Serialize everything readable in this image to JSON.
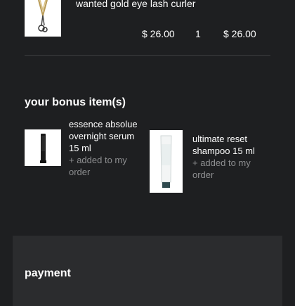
{
  "cart": {
    "item": {
      "name": "wanted gold eye lash curler",
      "price": "$ 26.00",
      "quantity": "1",
      "total": "$ 26.00",
      "image_icon": "eyelash-curler-image"
    }
  },
  "bonus": {
    "title": "your bonus item(s)",
    "items": [
      {
        "name": "essence absolue overnight serum 15 ml",
        "status": "+ added to my order",
        "image_icon": "serum-tube-image"
      },
      {
        "name": "ultimate reset shampoo 15 ml",
        "status": "+ added to my order",
        "image_icon": "shampoo-tube-image"
      }
    ]
  },
  "payment": {
    "title": "payment"
  },
  "colors": {
    "background": "#1e1f21",
    "panel": "#2b2c2e",
    "muted_text": "#8d8e90",
    "divider": "#3a3b3d"
  }
}
